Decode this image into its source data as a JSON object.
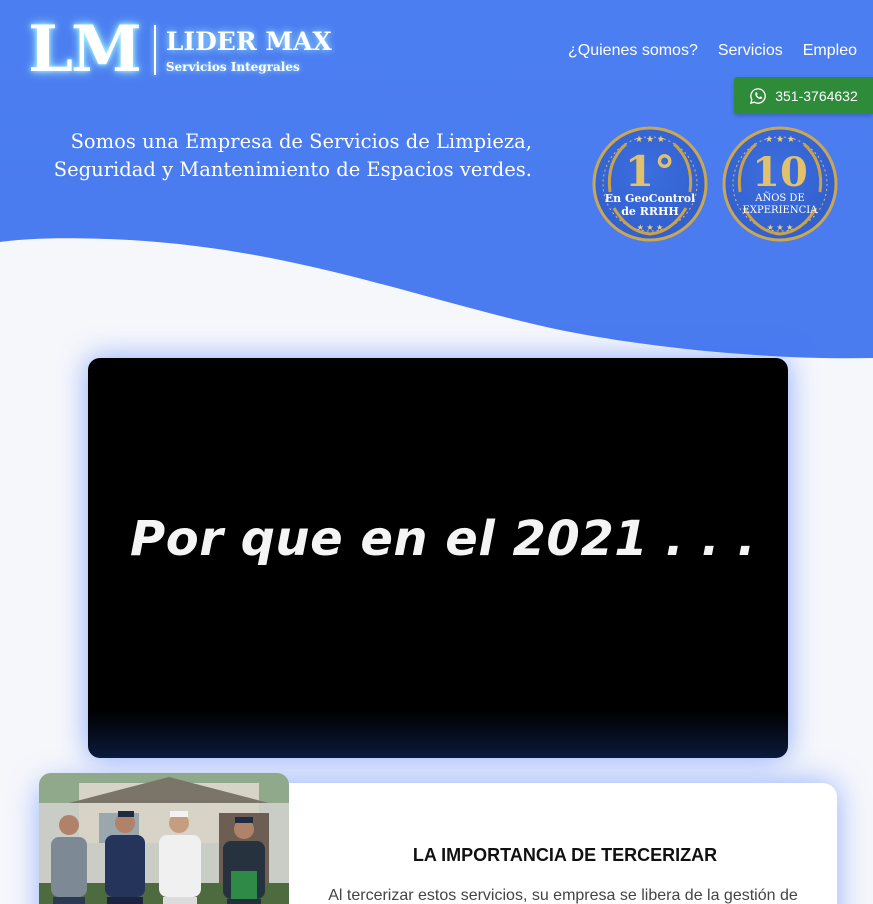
{
  "brand": {
    "logo_mark": "LM",
    "name": "LIDER MAX",
    "subtitle": "Servicios Integrales"
  },
  "nav": {
    "items": [
      {
        "label": "¿Quienes somos?"
      },
      {
        "label": "Servicios"
      },
      {
        "label": "Empleo"
      }
    ]
  },
  "contact": {
    "whatsapp_label": "351-3764632",
    "icon": "whatsapp-icon"
  },
  "hero": {
    "line1": "Somos una Empresa de Servicios de Limpieza,",
    "line2": "Seguridad y Mantenimiento de Espacios verdes."
  },
  "badges": [
    {
      "big": "1°",
      "line1": "En GeoControl",
      "line2": "de RRHH"
    },
    {
      "big": "10",
      "line1": "AÑOS DE",
      "line2": "EXPERIENCIA"
    }
  ],
  "video": {
    "title": "Por que en el 2021 . . ."
  },
  "section": {
    "title": "LA IMPORTANCIA DE TERCERIZAR",
    "text": "Al tercerizar estos servicios, su empresa se libera de la gestión de"
  },
  "colors": {
    "primary": "#4a7ff0",
    "whatsapp": "#2e8b3a",
    "gold": "#c9a24a",
    "video_bg": "#000000"
  }
}
